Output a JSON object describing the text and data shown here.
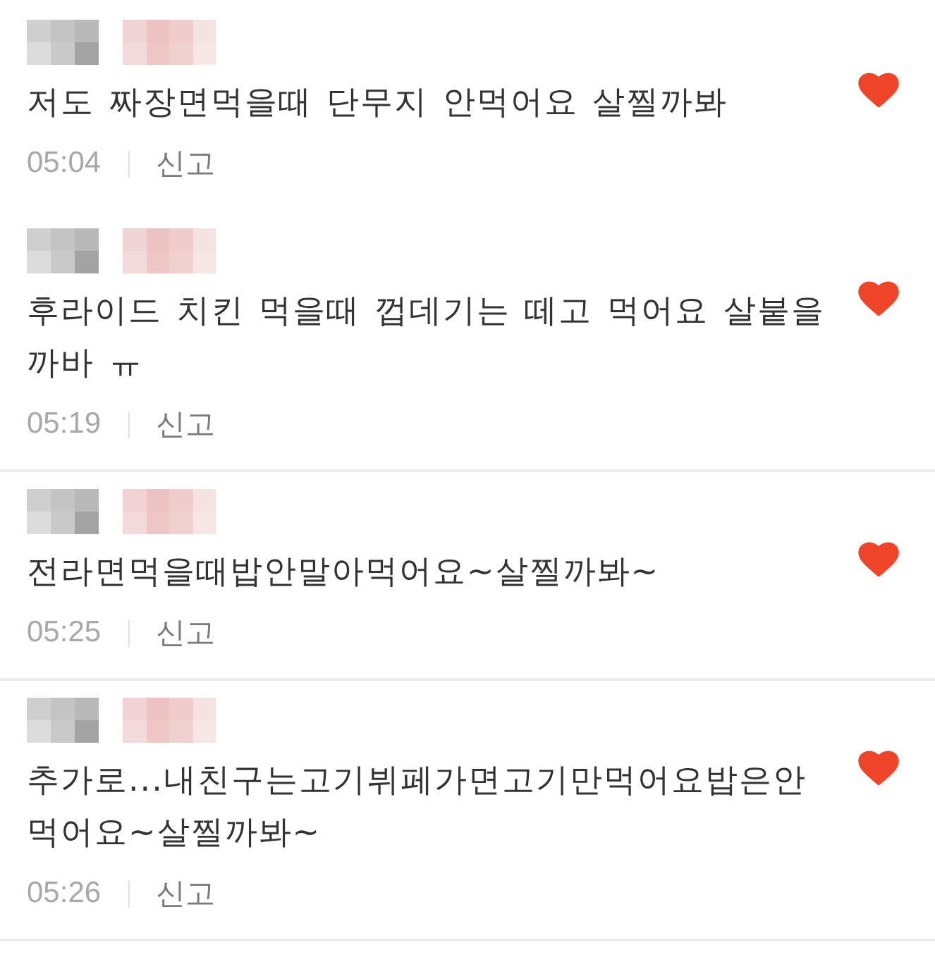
{
  "comments": [
    {
      "text": "저도 짜장면먹을때 단무지 안먹어요 살찔까봐",
      "time": "05:04",
      "report": "신고",
      "liked": true,
      "divider_below": false
    },
    {
      "text": "후라이드 치킨 먹을때 껍데기는 떼고 먹어요 살붙을 까바 ㅠ",
      "time": "05:19",
      "report": "신고",
      "liked": true,
      "divider_below": true
    },
    {
      "text": "전라면먹을때밥안말아먹어요~살찔까봐~",
      "time": "05:25",
      "report": "신고",
      "liked": true,
      "divider_below": true
    },
    {
      "text": "추가로...내친구는고기뷔페가면고기만먹어요밥은안 먹어요~살찔까봐~",
      "time": "05:26",
      "report": "신고",
      "liked": true,
      "divider_below": true
    }
  ]
}
